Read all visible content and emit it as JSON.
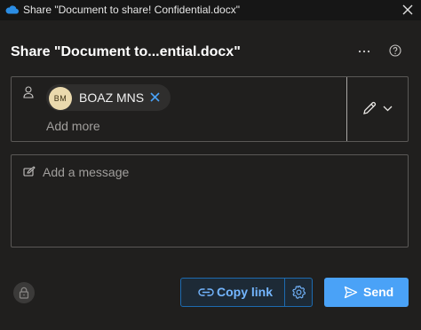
{
  "window": {
    "title": "Share \"Document to share! Confidential.docx\"",
    "icon": "onedrive-cloud-icon"
  },
  "dialog": {
    "heading": "Share \"Document to...ential.docx\""
  },
  "recipients": {
    "people": [
      {
        "initials": "BM",
        "name": "BOAZ MNS",
        "avatar_color": "#ead9ad"
      }
    ],
    "add_more_placeholder": "Add more",
    "permission_icon": "pencil-icon"
  },
  "message": {
    "placeholder": "Add a message"
  },
  "footer": {
    "copy_link_label": "Copy link",
    "send_label": "Send"
  },
  "colors": {
    "background": "#201f1e",
    "accent": "#4aa2f7",
    "link_text": "#74b6ff",
    "border": "#5a5856"
  }
}
